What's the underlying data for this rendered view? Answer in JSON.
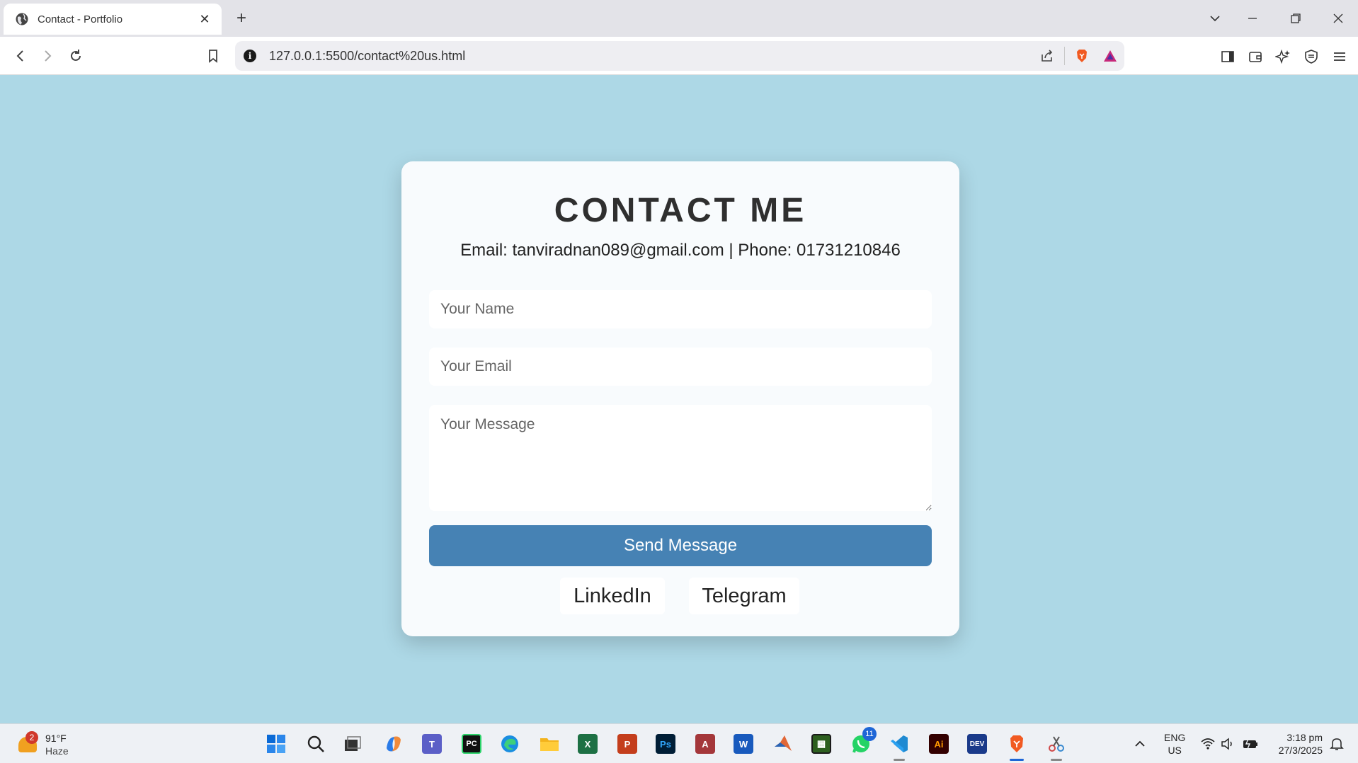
{
  "browser": {
    "tab_title": "Contact - Portfolio",
    "tab_close": "✕",
    "new_tab": "+",
    "url": "127.0.0.1:5500/contact%20us.html"
  },
  "page": {
    "heading": "CONTACT ME",
    "contact_info": "Email: tanviradnan089@gmail.com | Phone: 01731210846",
    "form": {
      "name_placeholder": "Your Name",
      "email_placeholder": "Your Email",
      "message_placeholder": "Your Message",
      "submit_label": "Send Message"
    },
    "social": {
      "linkedin": "LinkedIn",
      "telegram": "Telegram"
    },
    "colors": {
      "background": "#add8e6",
      "card": "#f8fbfd",
      "button": "#4682b4"
    }
  },
  "taskbar": {
    "weather": {
      "badge": "2",
      "temp": "91°F",
      "condition": "Haze"
    },
    "whatsapp_badge": "11",
    "lang_line1": "ENG",
    "lang_line2": "US",
    "time": "3:18 pm",
    "date": "27/3/2025"
  }
}
